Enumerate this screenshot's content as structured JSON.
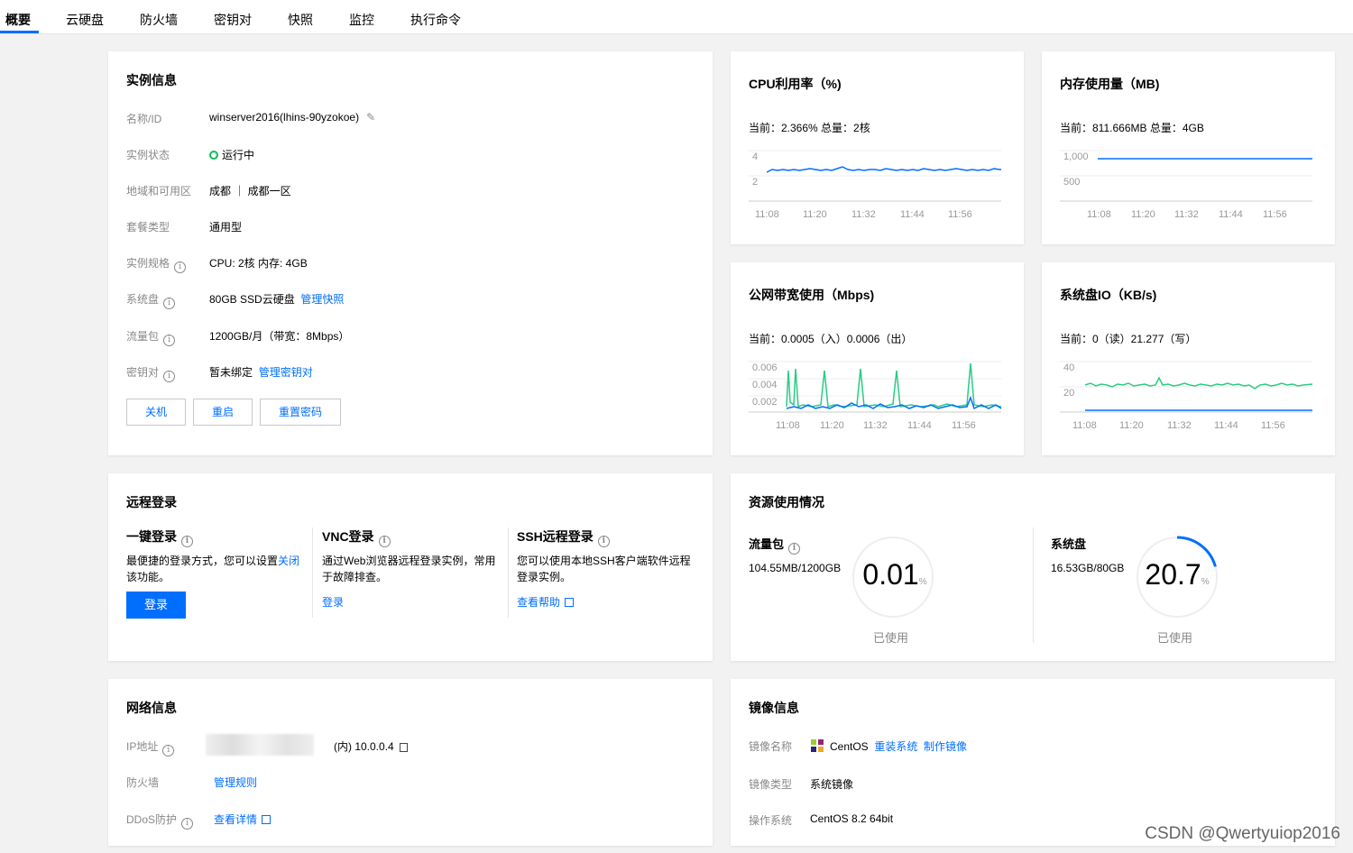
{
  "tabs": [
    "概要",
    "云硬盘",
    "防火墙",
    "密钥对",
    "快照",
    "监控",
    "执行命令"
  ],
  "instance_info": {
    "title": "实例信息",
    "name_label": "名称/ID",
    "name_value": "winserver2016(lhins-90yzokoe)",
    "status_label": "实例状态",
    "status_value": "运行中",
    "region_label": "地域和可用区",
    "region_value": "成都 ｜ 成都一区",
    "plan_label": "套餐类型",
    "plan_value": "通用型",
    "spec_label": "实例规格",
    "spec_value": "CPU: 2核 内存: 4GB",
    "disk_label": "系统盘",
    "disk_value": "80GB SSD云硬盘",
    "disk_link": "管理快照",
    "traffic_label": "流量包",
    "traffic_value": "1200GB/月（带宽：8Mbps）",
    "key_label": "密钥对",
    "key_value": "暂未绑定",
    "key_link": "管理密钥对",
    "btn_shutdown": "关机",
    "btn_restart": "重启",
    "btn_reset_pw": "重置密码"
  },
  "cpu": {
    "title": "CPU利用率（%)",
    "current": "当前：2.366% 总量：2核",
    "y_ticks": [
      "4",
      "2"
    ],
    "x_ticks": [
      "11:08",
      "11:20",
      "11:32",
      "11:44",
      "11:56"
    ],
    "color": "#006eff"
  },
  "memory": {
    "title": "内存使用量（MB)",
    "current": "当前：811.666MB 总量：4GB",
    "y_ticks": [
      "1,000",
      "500"
    ],
    "x_ticks": [
      "11:08",
      "11:20",
      "11:32",
      "11:44",
      "11:56"
    ],
    "color": "#006eff"
  },
  "bandwidth": {
    "title": "公网带宽使用（Mbps)",
    "current": "当前：0.0005（入）0.0006（出）",
    "y_ticks": [
      "0.006",
      "0.004",
      "0.002"
    ],
    "x_ticks": [
      "11:08",
      "11:20",
      "11:32",
      "11:44",
      "11:56"
    ],
    "color_in": "#006eff",
    "color_out": "#29cc85"
  },
  "diskio": {
    "title": "系统盘IO（KB/s)",
    "current": "当前：0（读）21.277（写）",
    "y_ticks": [
      "40",
      "20"
    ],
    "x_ticks": [
      "11:08",
      "11:20",
      "11:32",
      "11:44",
      "11:56"
    ],
    "color_read": "#006eff",
    "color_write": "#29cc85"
  },
  "remote": {
    "title": "远程登录",
    "col1_title": "一键登录",
    "col1_desc": "最便捷的登录方式，您可以设置",
    "col1_desc_link": "关闭",
    "col1_desc_tail": "该功能。",
    "col1_btn": "登录",
    "col2_title": "VNC登录",
    "col2_desc": "通过Web浏览器远程登录实例，常用于故障排查。",
    "col2_link": "登录",
    "col3_title": "SSH远程登录",
    "col3_desc": "您可以使用本地SSH客户端软件远程登录实例。",
    "col3_link": "查看帮助"
  },
  "resource": {
    "title": "资源使用情况",
    "traffic_title": "流量包",
    "traffic_value": "104.55MB/1200GB",
    "traffic_percent": "0.01",
    "traffic_percent_fraction": 0.0001,
    "disk_title": "系统盘",
    "disk_value": "16.53GB/80GB",
    "disk_percent": "20.7",
    "disk_percent_fraction": 0.207,
    "unit": "%",
    "used_label": "已使用"
  },
  "network": {
    "title": "网络信息",
    "ip_label": "IP地址",
    "ip_private": "(内) 10.0.0.4",
    "fw_label": "防火墙",
    "fw_link": "管理规则",
    "ddos_label": "DDoS防护",
    "ddos_link": "查看详情"
  },
  "image": {
    "title": "镜像信息",
    "name_label": "镜像名称",
    "name_value": "CentOS",
    "reinstall_link": "重装系统",
    "make_link": "制作镜像",
    "type_label": "镜像类型",
    "type_value": "系统镜像",
    "os_label": "操作系统",
    "os_value": "CentOS 8.2 64bit"
  },
  "watermark": "CSDN @Qwertyuiop2016"
}
